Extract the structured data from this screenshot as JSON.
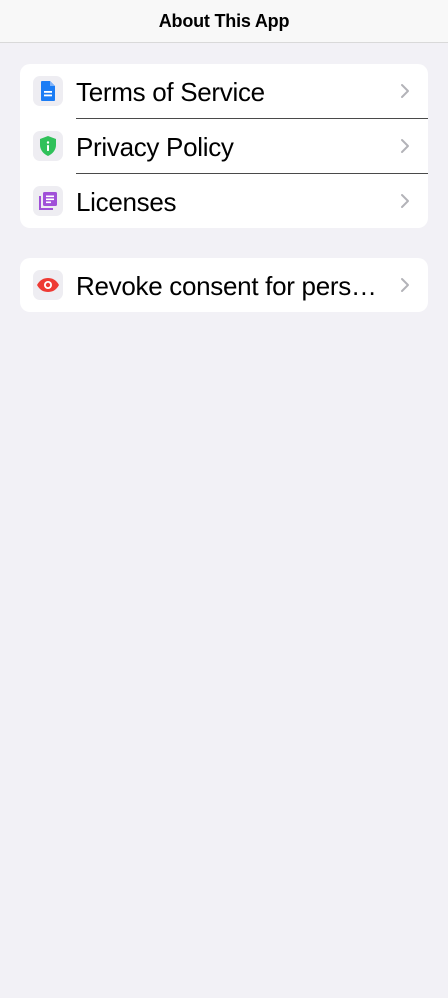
{
  "nav": {
    "title": "About This App"
  },
  "sections": [
    {
      "items": [
        {
          "label": "Terms of Service",
          "icon": "document-icon",
          "icon_color": "#1a7cf5"
        },
        {
          "label": "Privacy Policy",
          "icon": "shield-icon",
          "icon_color": "#30c15a"
        },
        {
          "label": "Licenses",
          "icon": "licenses-icon",
          "icon_color": "#a050d8"
        }
      ]
    },
    {
      "items": [
        {
          "label": "Revoke consent for personalized ads",
          "icon": "eye-icon",
          "icon_color": "#ee3a34"
        }
      ]
    }
  ],
  "colors": {
    "background": "#f2f1f6",
    "card": "#ffffff",
    "chevron": "#b3b3b8"
  }
}
